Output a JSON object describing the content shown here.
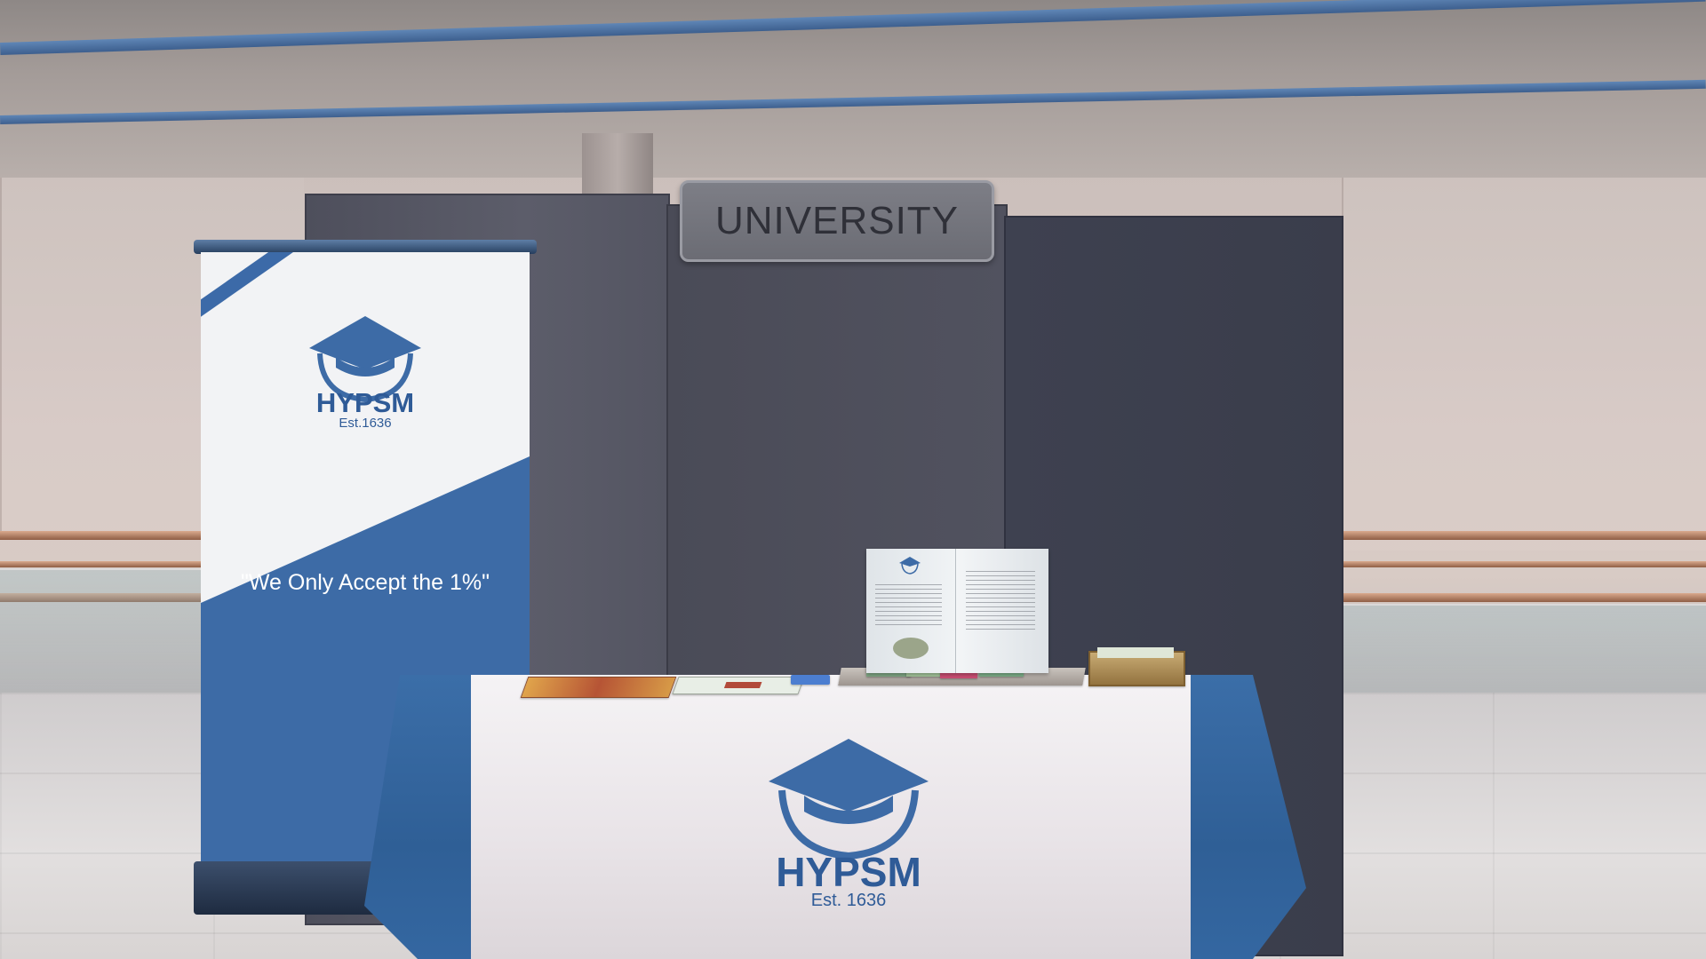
{
  "scene": {
    "sign_text": "UNIVERSITY",
    "banner": {
      "brand_name": "HYPSM",
      "established": "Est.1636",
      "slogan": "\"We Only Accept the 1%\""
    },
    "table_runner": {
      "brand_name": "HYPSM",
      "established": "Est. 1636"
    },
    "booklet": {
      "brand_name": "HYPSM"
    }
  },
  "colors": {
    "brand_blue": "#3d6ba6",
    "booth_panel": "#4e4f5c",
    "wall": "#d6c9c4",
    "cloth_white": "#f5f3f5"
  }
}
